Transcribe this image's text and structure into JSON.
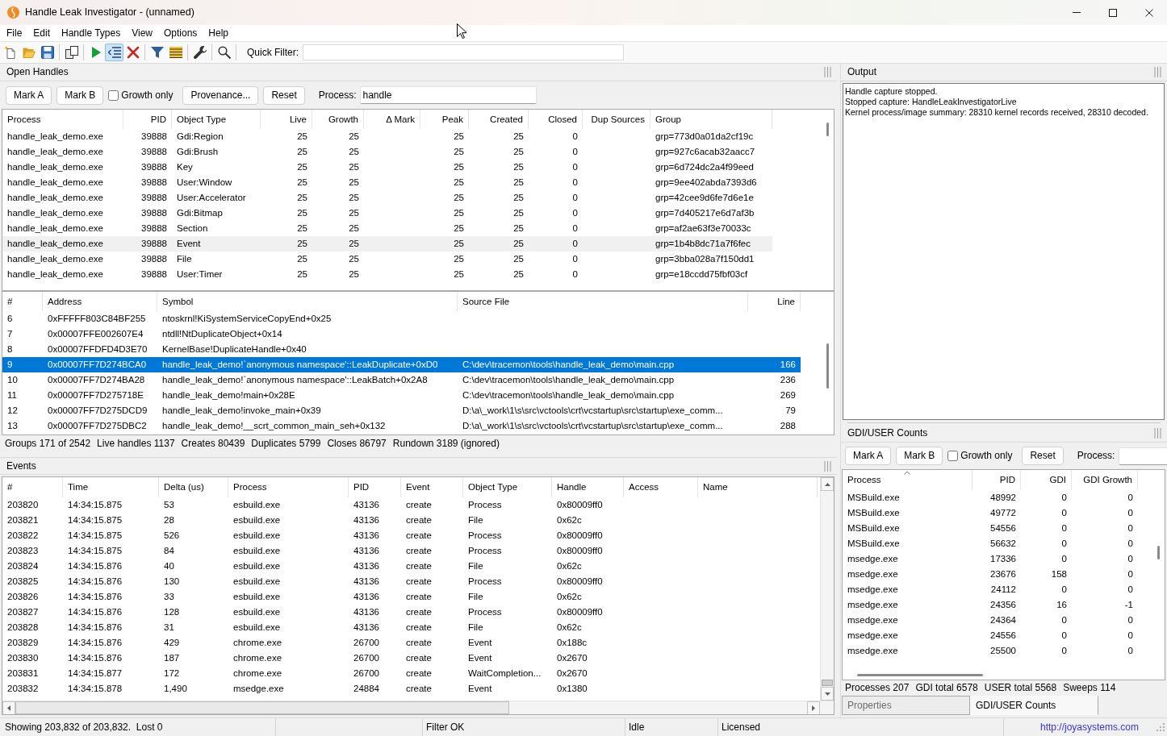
{
  "window": {
    "title": "Handle Leak Investigator - (unnamed)"
  },
  "menu": [
    "File",
    "Edit",
    "Handle Types",
    "View",
    "Options",
    "Help"
  ],
  "toolbar": {
    "buttons": [
      {
        "pressed": false
      },
      {
        "pressed": false
      },
      {
        "pressed": false
      },
      {
        "pressed": false
      },
      {
        "pressed": false
      },
      {
        "pressed": true
      },
      {
        "pressed": false
      },
      {
        "pressed": false
      },
      {
        "pressed": false
      },
      {
        "pressed": false
      },
      {
        "pressed": false
      }
    ],
    "quick_filter": {
      "label": "Quick Filter:"
    }
  },
  "open_handles": {
    "title": "Open Handles",
    "controls": [
      {
        "kind": "button",
        "label": "Mark A"
      },
      {
        "kind": "button",
        "label": "Mark B"
      },
      {
        "kind": "checkbox",
        "label": "Growth only",
        "checked": false
      },
      {
        "kind": "button",
        "label": "Provenance..."
      },
      {
        "kind": "button",
        "label": "Reset"
      },
      {
        "kind": "field",
        "label": "Process:",
        "value": "handle"
      }
    ],
    "handles_table": {
      "columns": [
        "Process",
        "PID",
        "Object Type",
        "Live",
        "Growth",
        "Δ Mark",
        "Peak",
        "Created",
        "Closed",
        "Dup Sources",
        "Group"
      ],
      "rows": [
        {
          "process": "handle_leak_demo.exe",
          "pid": "39888",
          "object_type": "Gdi:Region",
          "live": "25",
          "growth": "25",
          "peak": "25",
          "created": "25",
          "closed": "0",
          "group": "grp=773d0a01da2cf19c",
          "selected": false
        },
        {
          "process": "handle_leak_demo.exe",
          "pid": "39888",
          "object_type": "Gdi:Brush",
          "live": "25",
          "growth": "25",
          "peak": "25",
          "created": "25",
          "closed": "0",
          "group": "grp=927c6acab32aacc7",
          "selected": false
        },
        {
          "process": "handle_leak_demo.exe",
          "pid": "39888",
          "object_type": "Key",
          "live": "25",
          "growth": "25",
          "peak": "25",
          "created": "25",
          "closed": "0",
          "group": "grp=6d724dc2a4f99eed",
          "selected": false
        },
        {
          "process": "handle_leak_demo.exe",
          "pid": "39888",
          "object_type": "User:Window",
          "live": "25",
          "growth": "25",
          "peak": "25",
          "created": "25",
          "closed": "0",
          "group": "grp=9ee402abda7393d6",
          "selected": false
        },
        {
          "process": "handle_leak_demo.exe",
          "pid": "39888",
          "object_type": "User:Accelerator",
          "live": "25",
          "growth": "25",
          "peak": "25",
          "created": "25",
          "closed": "0",
          "group": "grp=42cee9d6fe7d6e1e",
          "selected": false
        },
        {
          "process": "handle_leak_demo.exe",
          "pid": "39888",
          "object_type": "Gdi:Bitmap",
          "live": "25",
          "growth": "25",
          "peak": "25",
          "created": "25",
          "closed": "0",
          "group": "grp=7d405217e6d7af3b",
          "selected": false
        },
        {
          "process": "handle_leak_demo.exe",
          "pid": "39888",
          "object_type": "Section",
          "live": "25",
          "growth": "25",
          "peak": "25",
          "created": "25",
          "closed": "0",
          "group": "grp=af2ae63f3e70033c",
          "selected": false
        },
        {
          "process": "handle_leak_demo.exe",
          "pid": "39888",
          "object_type": "Event",
          "live": "25",
          "growth": "25",
          "peak": "25",
          "created": "25",
          "closed": "0",
          "group": "grp=1b4b8dc71a7f6fec",
          "selected": true
        },
        {
          "process": "handle_leak_demo.exe",
          "pid": "39888",
          "object_type": "File",
          "live": "25",
          "growth": "25",
          "peak": "25",
          "created": "25",
          "closed": "0",
          "group": "grp=3bba028a7f150dd1",
          "selected": false
        },
        {
          "process": "handle_leak_demo.exe",
          "pid": "39888",
          "object_type": "User:Timer",
          "live": "25",
          "growth": "25",
          "peak": "25",
          "created": "25",
          "closed": "0",
          "group": "grp=e18ccdd75fbf03cf",
          "selected": false
        }
      ]
    },
    "stack_table": {
      "columns": [
        "#",
        "Address",
        "Symbol",
        "Source File",
        "Line"
      ],
      "rows": [
        {
          "frame": "6",
          "address": "0xFFFFF803C84BF255",
          "symbol": "ntoskrnl!KiSystemServiceCopyEnd+0x25",
          "selected": false
        },
        {
          "frame": "7",
          "address": "0x00007FFE002607E4",
          "symbol": "ntdll!NtDuplicateObject+0x14",
          "selected": false
        },
        {
          "frame": "8",
          "address": "0x00007FFDFD4D3E70",
          "symbol": "KernelBase!DuplicateHandle+0x40",
          "selected": false
        },
        {
          "frame": "9",
          "address": "0x00007FF7D274BCA0",
          "symbol": "handle_leak_demo!`anonymous namespace'::LeakDuplicate+0xD0",
          "source_file": "C:\\dev\\tracemon\\tools\\handle_leak_demo\\main.cpp",
          "line": "166",
          "selected": true
        },
        {
          "frame": "10",
          "address": "0x00007FF7D274BA28",
          "symbol": "handle_leak_demo!`anonymous namespace'::LeakBatch+0x2A8",
          "source_file": "C:\\dev\\tracemon\\tools\\handle_leak_demo\\main.cpp",
          "line": "236",
          "selected": false
        },
        {
          "frame": "11",
          "address": "0x00007FF7D275718E",
          "symbol": "handle_leak_demo!main+0x28E",
          "source_file": "C:\\dev\\tracemon\\tools\\handle_leak_demo\\main.cpp",
          "line": "269",
          "selected": false
        },
        {
          "frame": "12",
          "address": "0x00007FF7D275DCD9",
          "symbol": "handle_leak_demo!invoke_main+0x39",
          "source_file": "D:\\a\\_work\\1\\s\\src\\vctools\\crt\\vcstartup\\src\\startup\\exe_comm...",
          "line": "79",
          "selected": false
        },
        {
          "frame": "13",
          "address": "0x00007FF7D275DBC2",
          "symbol": "handle_leak_demo!__scrt_common_main_seh+0x132",
          "source_file": "D:\\a\\_work\\1\\s\\src\\vctools\\crt\\vcstartup\\src\\startup\\exe_comm...",
          "line": "288",
          "selected": false
        }
      ]
    },
    "summary": [
      "Groups 171 of 2542",
      "Live handles 1137",
      "Creates 80439",
      "Duplicates 5799",
      "Closes 86797",
      "Rundown 3189 (ignored)"
    ]
  },
  "events": {
    "title": "Events",
    "table": {
      "columns": [
        "#",
        "Time",
        "Delta (us)",
        "Process",
        "PID",
        "Event",
        "Object Type",
        "Handle",
        "Access",
        "Name"
      ],
      "rows": [
        {
          "number": "203820",
          "time": "14:34:15.875",
          "delta_us": "53",
          "process": "esbuild.exe",
          "pid": "43136",
          "event": "create",
          "object_type": "Process",
          "handle": "0x80009ff0"
        },
        {
          "number": "203821",
          "time": "14:34:15.875",
          "delta_us": "28",
          "process": "esbuild.exe",
          "pid": "43136",
          "event": "create",
          "object_type": "File",
          "handle": "0x62c"
        },
        {
          "number": "203822",
          "time": "14:34:15.875",
          "delta_us": "526",
          "process": "esbuild.exe",
          "pid": "43136",
          "event": "create",
          "object_type": "Process",
          "handle": "0x80009ff0"
        },
        {
          "number": "203823",
          "time": "14:34:15.875",
          "delta_us": "84",
          "process": "esbuild.exe",
          "pid": "43136",
          "event": "create",
          "object_type": "Process",
          "handle": "0x80009ff0"
        },
        {
          "number": "203824",
          "time": "14:34:15.876",
          "delta_us": "40",
          "process": "esbuild.exe",
          "pid": "43136",
          "event": "create",
          "object_type": "File",
          "handle": "0x62c"
        },
        {
          "number": "203825",
          "time": "14:34:15.876",
          "delta_us": "130",
          "process": "esbuild.exe",
          "pid": "43136",
          "event": "create",
          "object_type": "Process",
          "handle": "0x80009ff0"
        },
        {
          "number": "203826",
          "time": "14:34:15.876",
          "delta_us": "33",
          "process": "esbuild.exe",
          "pid": "43136",
          "event": "create",
          "object_type": "File",
          "handle": "0x62c"
        },
        {
          "number": "203827",
          "time": "14:34:15.876",
          "delta_us": "128",
          "process": "esbuild.exe",
          "pid": "43136",
          "event": "create",
          "object_type": "Process",
          "handle": "0x80009ff0"
        },
        {
          "number": "203828",
          "time": "14:34:15.876",
          "delta_us": "31",
          "process": "esbuild.exe",
          "pid": "43136",
          "event": "create",
          "object_type": "File",
          "handle": "0x62c"
        },
        {
          "number": "203829",
          "time": "14:34:15.876",
          "delta_us": "429",
          "process": "chrome.exe",
          "pid": "26700",
          "event": "create",
          "object_type": "Event",
          "handle": "0x188c"
        },
        {
          "number": "203830",
          "time": "14:34:15.876",
          "delta_us": "187",
          "process": "chrome.exe",
          "pid": "26700",
          "event": "create",
          "object_type": "Event",
          "handle": "0x2670"
        },
        {
          "number": "203831",
          "time": "14:34:15.877",
          "delta_us": "172",
          "process": "chrome.exe",
          "pid": "26700",
          "event": "create",
          "object_type": "WaitCompletion...",
          "handle": "0x2670"
        },
        {
          "number": "203832",
          "time": "14:34:15.878",
          "delta_us": "1,490",
          "process": "msedge.exe",
          "pid": "24884",
          "event": "create",
          "object_type": "Event",
          "handle": "0x1380"
        }
      ]
    }
  },
  "output": {
    "title": "Output",
    "lines": [
      "Handle capture stopped.",
      "Stopped capture: HandleLeakInvestigatorLive",
      "Kernel process/image summary: 28310 kernel records received, 28310 decoded."
    ]
  },
  "gdi_user_counts": {
    "title": "GDI/USER Counts",
    "controls": [
      {
        "kind": "button",
        "label": "Mark A"
      },
      {
        "kind": "button",
        "label": "Mark B"
      },
      {
        "kind": "checkbox",
        "label": "Growth only",
        "checked": false
      },
      {
        "kind": "button",
        "label": "Reset"
      },
      {
        "kind": "field",
        "label": "Process:"
      }
    ],
    "table": {
      "columns": [
        {
          "label": "Process",
          "sorted": true
        },
        {
          "label": "PID",
          "sorted": false
        },
        {
          "label": "GDI",
          "sorted": false
        },
        {
          "label": "GDI Growth",
          "sorted": false
        }
      ],
      "rows": [
        {
          "process": "MSBuild.exe",
          "pid": "48992",
          "gdi": "0",
          "gdi_growth": "0"
        },
        {
          "process": "MSBuild.exe",
          "pid": "49772",
          "gdi": "0",
          "gdi_growth": "0"
        },
        {
          "process": "MSBuild.exe",
          "pid": "54556",
          "gdi": "0",
          "gdi_growth": "0"
        },
        {
          "process": "MSBuild.exe",
          "pid": "56632",
          "gdi": "0",
          "gdi_growth": "0"
        },
        {
          "process": "msedge.exe",
          "pid": "17336",
          "gdi": "0",
          "gdi_growth": "0"
        },
        {
          "process": "msedge.exe",
          "pid": "23676",
          "gdi": "158",
          "gdi_growth": "0"
        },
        {
          "process": "msedge.exe",
          "pid": "24112",
          "gdi": "0",
          "gdi_growth": "0"
        },
        {
          "process": "msedge.exe",
          "pid": "24356",
          "gdi": "16",
          "gdi_growth": "-1"
        },
        {
          "process": "msedge.exe",
          "pid": "24364",
          "gdi": "0",
          "gdi_growth": "0"
        },
        {
          "process": "msedge.exe",
          "pid": "24556",
          "gdi": "0",
          "gdi_growth": "0"
        },
        {
          "process": "msedge.exe",
          "pid": "25500",
          "gdi": "0",
          "gdi_growth": "0"
        }
      ]
    },
    "summary": [
      "Processes 207",
      "GDI total 6578",
      "USER total 5568",
      "Sweeps 114"
    ],
    "tabs": [
      {
        "label": "Properties",
        "selected": false
      },
      {
        "label": "GDI/USER Counts",
        "selected": true
      }
    ]
  },
  "status_bar": {
    "message": "Showing 203,832 of 203,832.  Lost 0",
    "filter": "Filter OK",
    "state": "Idle",
    "license": "Licensed",
    "link": "http://joyasystems.com"
  }
}
